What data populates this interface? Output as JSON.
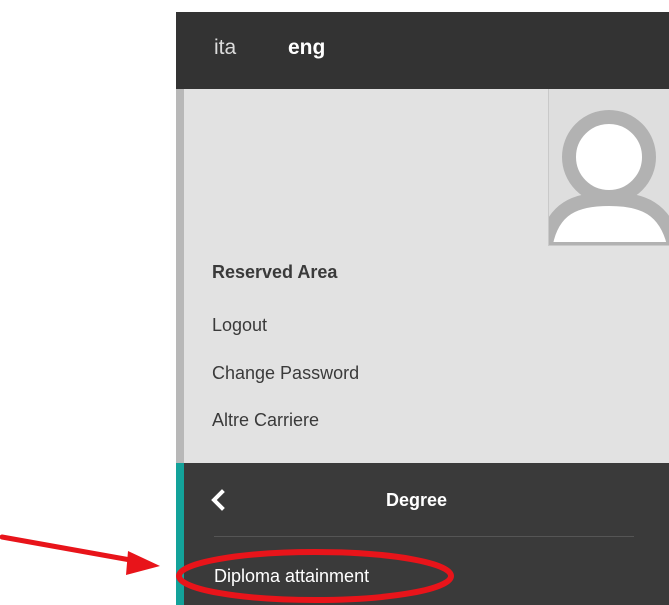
{
  "languages": {
    "ita": "ita",
    "eng": "eng",
    "selected": "eng"
  },
  "user_area": {
    "avatar_icon": "user-avatar-icon",
    "title": "Reserved Area",
    "links": [
      "Logout",
      "Change Password",
      "Altre Carriere"
    ]
  },
  "degree_menu": {
    "back_icon": "chevron-left-icon",
    "title": "Degree",
    "items": [
      "Diploma attainment"
    ]
  },
  "annotation": {
    "arrow_color": "#e8141a",
    "highlight_color": "#e8141a",
    "target": "Diploma attainment"
  },
  "colors": {
    "topbar": "#333333",
    "user_area_bg": "#e2e2e2",
    "degree_bg": "#3a3a3a",
    "accent_teal": "#13a29a"
  }
}
